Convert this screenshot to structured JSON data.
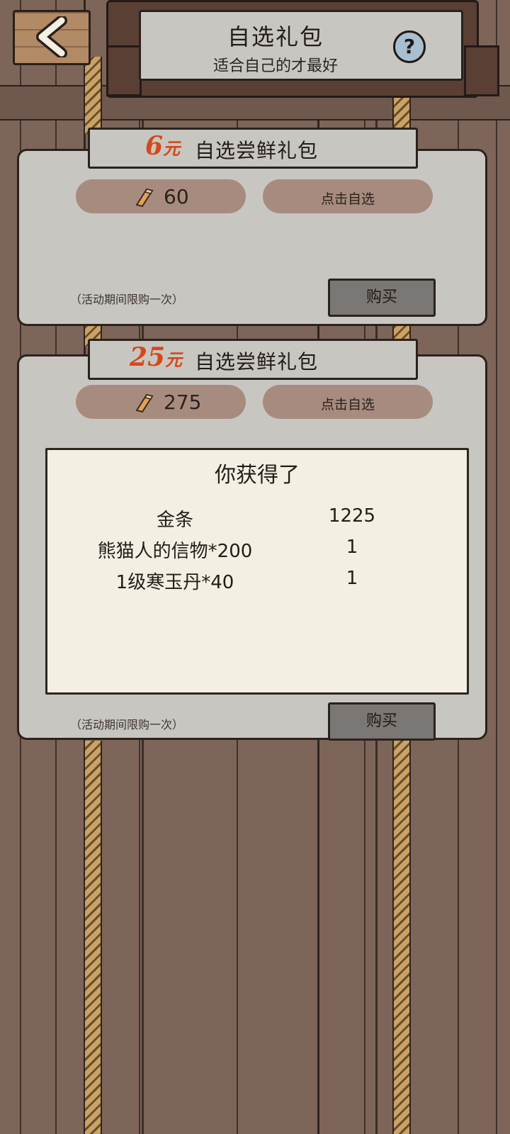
{
  "header": {
    "title": "自选礼包",
    "subtitle": "适合自己的才最好",
    "help_label": "?"
  },
  "packs": [
    {
      "price_number": "6",
      "price_unit": "元",
      "name": "自选尝鲜礼包",
      "gold_amount": "60",
      "pick_label": "点击自选",
      "limit_note": "（活动期间限购一次）",
      "buy_label": "购买"
    },
    {
      "price_number": "25",
      "price_unit": "元",
      "name": "自选尝鲜礼包",
      "gold_amount": "275",
      "pick_label": "点击自选",
      "limit_note": "（活动期间限购一次）",
      "buy_label": "购买"
    }
  ],
  "reward_dialog": {
    "title": "你获得了",
    "rewards": [
      {
        "name": "金条",
        "qty": "1225"
      },
      {
        "name": "熊猫人的信物*200",
        "qty": "1"
      },
      {
        "name": "1级寒玉丹*40",
        "qty": "1"
      }
    ]
  },
  "colors": {
    "wood_bg": "#7e6559",
    "card_bg": "#c8c6c1",
    "price_orange": "#d24a1c",
    "pill_bg": "#a88b7f",
    "buy_button": "#7a7774",
    "dialog_bg": "#f3efe2",
    "help_button": "#a8bfd0"
  },
  "icons": [
    "back-arrow-icon",
    "help-icon",
    "gold-bar-icon"
  ]
}
